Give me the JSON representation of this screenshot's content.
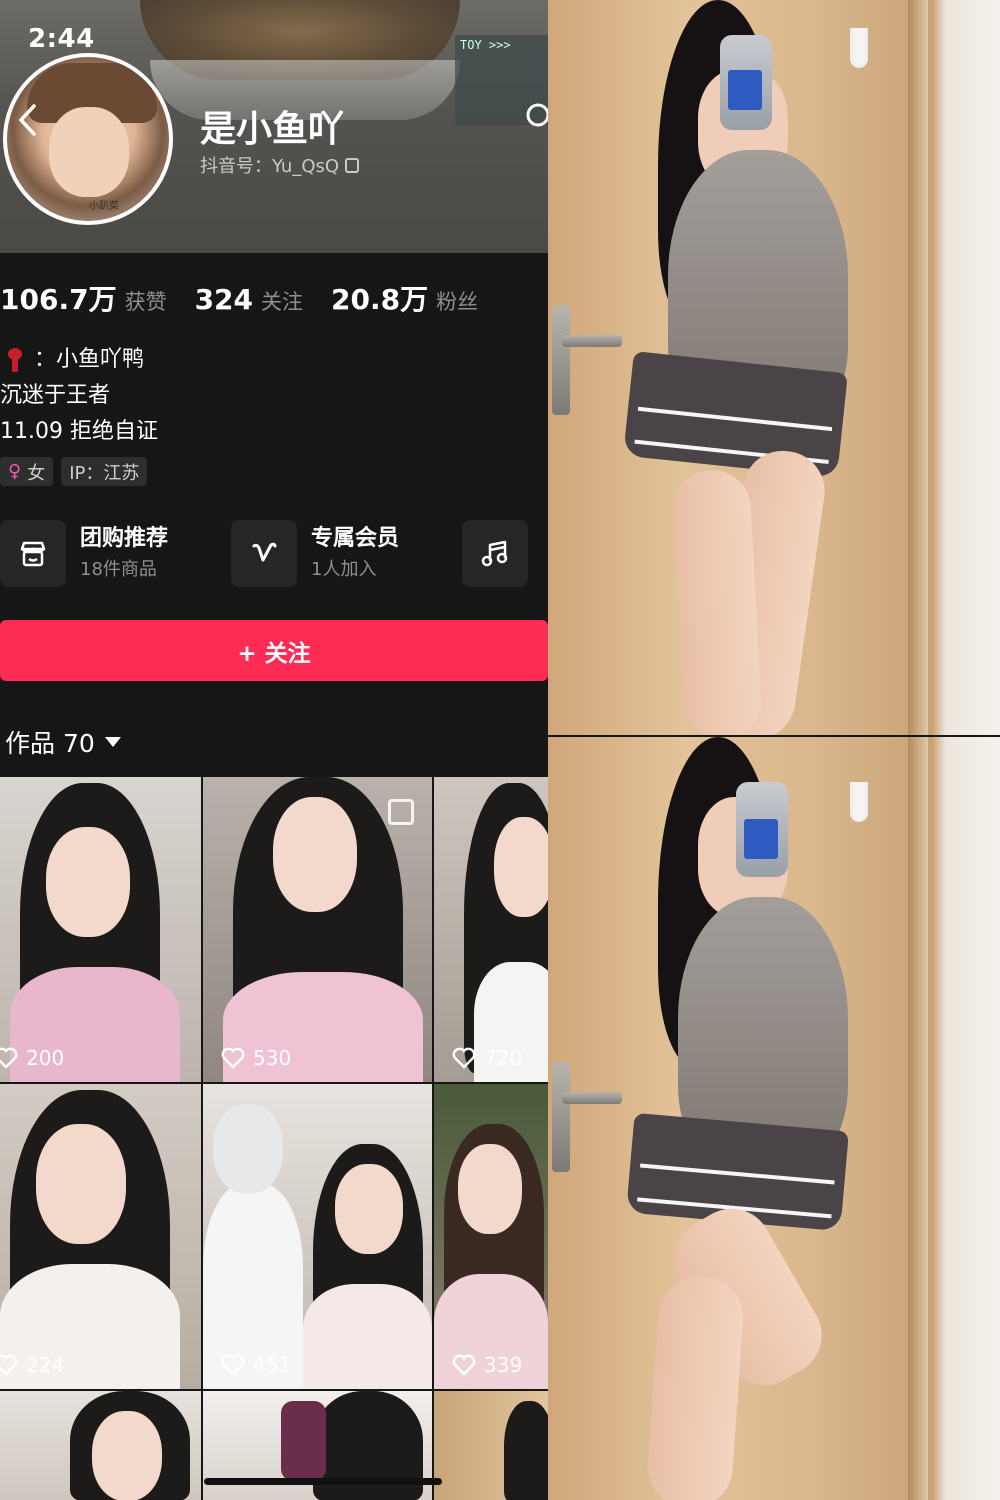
{
  "status_bar": {
    "time": "2:44"
  },
  "banner": {
    "panel_text": "TOY >>>"
  },
  "profile": {
    "avatar_label": "小趴菜",
    "username": "是小鱼吖",
    "douyin_id": "抖音号：Yu_QsQ"
  },
  "stats": [
    {
      "value": "106.7万",
      "label": "获赞"
    },
    {
      "value": "324",
      "label": "关注"
    },
    {
      "value": "20.8万",
      "label": "粉丝"
    }
  ],
  "bio": {
    "line1": "：小鱼吖鸭",
    "line2": "沉迷于王者",
    "line3": "11.09   拒绝自证"
  },
  "tags": {
    "gender": "女",
    "ip": "IP：江苏"
  },
  "services": [
    {
      "title": "团购推荐",
      "subtitle": "18件商品",
      "icon": "store-icon"
    },
    {
      "title": "专属会员",
      "subtitle": "1人加入",
      "icon": "vip-icon"
    },
    {
      "title": "",
      "subtitle": "",
      "icon": "music-icon"
    }
  ],
  "follow_button": {
    "label": "+ 关注"
  },
  "works": {
    "tab_label": "作品 70"
  },
  "videos": [
    {
      "likes": "200"
    },
    {
      "likes": "530"
    },
    {
      "likes": "720"
    },
    {
      "likes": "224"
    },
    {
      "likes": "451"
    },
    {
      "likes": "339"
    }
  ],
  "colors": {
    "accent": "#fe2c55",
    "background": "#161616"
  }
}
